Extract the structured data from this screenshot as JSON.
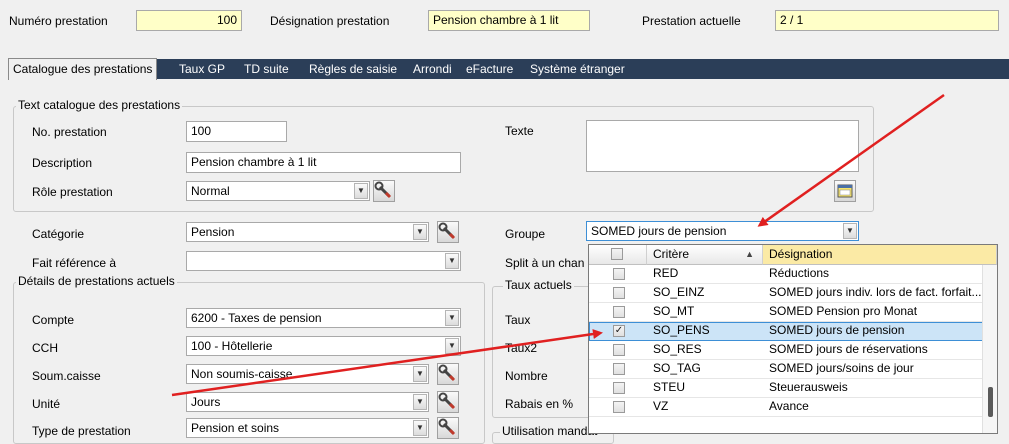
{
  "header": {
    "numero_label": "Numéro prestation",
    "numero_value": "100",
    "designation_label": "Désignation prestation",
    "designation_value": "Pension chambre à 1 lit",
    "actuelle_label": "Prestation actuelle",
    "actuelle_value": "2 / 1"
  },
  "tabs": [
    {
      "label": "Catalogue des prestations",
      "active": true
    },
    {
      "label": "Taux GP"
    },
    {
      "label": "TD suite"
    },
    {
      "label": "Règles de saisie"
    },
    {
      "label": "Arrondi"
    },
    {
      "label": "eFacture"
    },
    {
      "label": "Système étranger"
    }
  ],
  "catalogue": {
    "group_title": "Text catalogue des prestations",
    "no_label": "No. prestation",
    "no_value": "100",
    "desc_label": "Description",
    "desc_value": "Pension chambre à 1 lit",
    "role_label": "Rôle prestation",
    "role_value": "Normal",
    "texte_label": "Texte"
  },
  "fields": {
    "categorie_label": "Catégorie",
    "categorie_value": "Pension",
    "fait_ref_label": "Fait référence à",
    "groupe_label": "Groupe",
    "groupe_value": "SOMED jours de pension",
    "split_label": "Split à un chan"
  },
  "details": {
    "group_title": "Détails de prestations actuels",
    "compte_label": "Compte",
    "compte_value": "6200 - Taxes de pension",
    "cch_label": "CCH",
    "cch_value": "100 - Hôtellerie",
    "soum_label": "Soum.caisse",
    "soum_value": "Non soumis-caisse",
    "unite_label": "Unité",
    "unite_value": "Jours",
    "type_label": "Type de prestation",
    "type_value": "Pension et soins"
  },
  "taux": {
    "group_title": "Taux actuels",
    "taux_label": "Taux",
    "taux2_label": "Taux2",
    "nombre_label": "Nombre",
    "rabais_label": "Rabais en %"
  },
  "utilisation": {
    "group_title": "Utilisation mandat"
  },
  "dropdown": {
    "col_critere": "Critère",
    "col_designation": "Désignation",
    "rows": [
      {
        "critere": "RED",
        "designation": "Réductions",
        "checked": false
      },
      {
        "critere": "SO_EINZ",
        "designation": "SOMED jours indiv. lors de fact. forfait...",
        "checked": false
      },
      {
        "critere": "SO_MT",
        "designation": "SOMED Pension pro Monat",
        "checked": false
      },
      {
        "critere": "SO_PENS",
        "designation": "SOMED jours de pension",
        "checked": true,
        "selected": true
      },
      {
        "critere": "SO_RES",
        "designation": "SOMED jours de réservations",
        "checked": false
      },
      {
        "critere": "SO_TAG",
        "designation": "SOMED jours/soins de jour",
        "checked": false
      },
      {
        "critere": "STEU",
        "designation": "Steuerausweis",
        "checked": false
      },
      {
        "critere": "VZ",
        "designation": "Avance",
        "checked": false
      }
    ]
  },
  "colors": {
    "tabbar": "#2b3e58",
    "highlight_field": "#ffffc8",
    "arrow": "#e02020",
    "selection": "#cce4f7"
  }
}
